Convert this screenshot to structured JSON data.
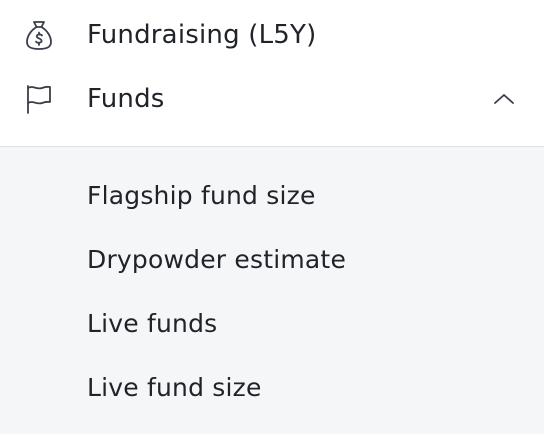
{
  "nav": {
    "items": [
      {
        "label": "Fundraising (L5Y)",
        "icon": "money-bag-icon"
      },
      {
        "label": "Funds",
        "icon": "flag-icon",
        "expanded": true,
        "chevron": "chevron-up-icon"
      }
    ],
    "submenu": [
      {
        "label": "Flagship fund size"
      },
      {
        "label": "Drypowder estimate"
      },
      {
        "label": "Live funds"
      },
      {
        "label": "Live fund size"
      }
    ]
  },
  "colors": {
    "text": "#20242a",
    "icon_stroke": "#3a3f47",
    "submenu_bg": "#f5f6f8",
    "divider": "#dde0e4"
  }
}
